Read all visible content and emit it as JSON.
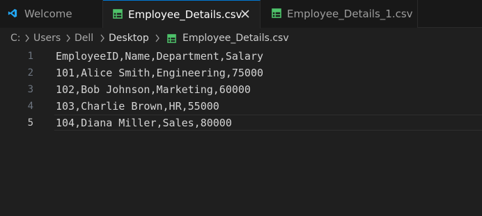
{
  "tabs": [
    {
      "label": "Welcome",
      "icon": "vscode-logo-icon",
      "active": false
    },
    {
      "label": "Employee_Details.csv",
      "icon": "csv-file-icon",
      "active": true
    },
    {
      "label": "Employee_Details_1.csv",
      "icon": "csv-file-icon",
      "active": false
    }
  ],
  "breadcrumb": [
    "C:",
    "Users",
    "Dell",
    "Desktop",
    "Employee_Details.csv"
  ],
  "editor": {
    "current_line": 5,
    "lines": [
      {
        "number": "1",
        "text": "EmployeeID,Name,Department,Salary"
      },
      {
        "number": "2",
        "text": "101,Alice Smith,Engineering,75000"
      },
      {
        "number": "3",
        "text": "102,Bob Johnson,Marketing,60000"
      },
      {
        "number": "4",
        "text": "103,Charlie Brown,HR,55000"
      },
      {
        "number": "5",
        "text": "104,Diana Miller,Sales,80000"
      }
    ]
  },
  "colors": {
    "accent": "#0078d4",
    "csv_icon": "#4ec26a",
    "vscode_logo": "#23a6f2",
    "editor_background": "#1f1f1f",
    "tabbar_background": "#181818"
  }
}
